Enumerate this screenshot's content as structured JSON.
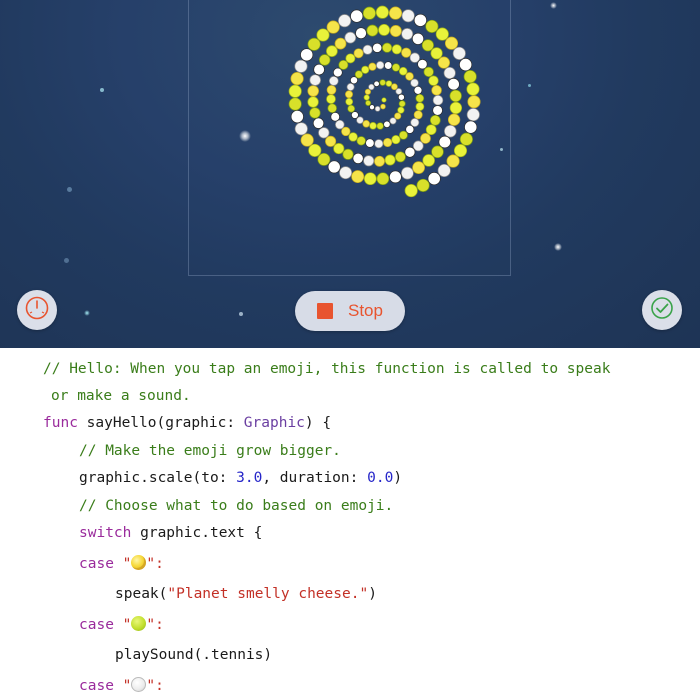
{
  "live_view": {
    "stop_button_label": "Stop",
    "accent_color": "#e8542f"
  },
  "code": {
    "line1_comment": "// Hello: When you tap an emoji, this function is called to speak",
    "line2_comment": "or make a sound.",
    "line3_kw": "func",
    "line3_fn": " sayHello(graphic: ",
    "line3_type": "Graphic",
    "line3_end": ") {",
    "line4_comment": "// Make the emoji grow bigger.",
    "line5_a": "graphic.scale(to: ",
    "line5_num1": "3.0",
    "line5_b": ", duration: ",
    "line5_num2": "0.0",
    "line5_c": ")",
    "line6_comment": "// Choose what to do based on emoji.",
    "line7_kw": "switch",
    "line7_rest": " graphic.text {",
    "case_kw": "case",
    "quote_open": " \"",
    "quote_close": "\":",
    "line9_fn": "speak(",
    "line9_str": "\"Planet smelly cheese.\"",
    "line9_end": ")",
    "line11": "playSound(.tennis)",
    "emoji_icons": [
      "planet-emoji",
      "tennis-ball-emoji",
      "baseball-emoji"
    ]
  }
}
